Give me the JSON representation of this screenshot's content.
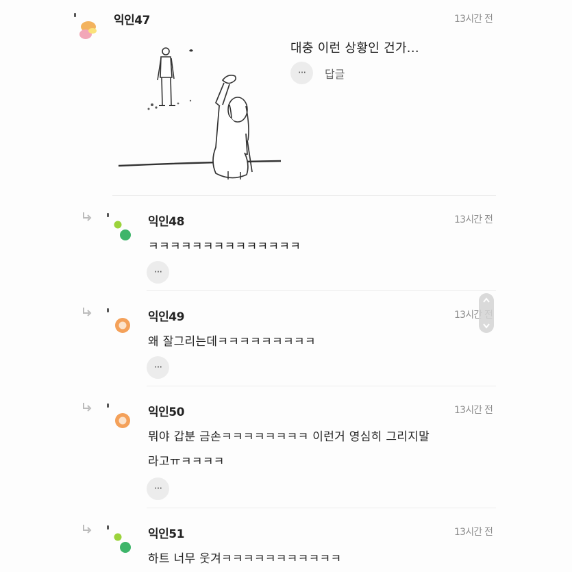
{
  "comments": [
    {
      "nick": "익인47",
      "time": "13시간 전",
      "text": "대충 이런 상황인 건가...",
      "reply_label": "답글",
      "more_label": "···",
      "avatar": "orange-pink-bubble-icon"
    },
    {
      "nick": "익인48",
      "time": "13시간 전",
      "text": "ㅋㅋㅋㅋㅋㅋㅋㅋㅋㅋㅋㅋㅋㅋ",
      "more_label": "···",
      "avatar": "green-dots-icon"
    },
    {
      "nick": "익인49",
      "time": "13시간 전",
      "text": "왜 잘그리는데ㅋㅋㅋㅋㅋㅋㅋㅋㅋ",
      "more_label": "···",
      "avatar": "orange-ring-icon"
    },
    {
      "nick": "익인50",
      "time": "13시간 전",
      "text_line1": "뭐야 갑분 금손ㅋㅋㅋㅋㅋㅋㅋㅋ 이런거 영심히 그리지말",
      "text_line2": "라고ㅠㅋㅋㅋㅋ",
      "more_label": "···",
      "avatar": "orange-ring-icon"
    },
    {
      "nick": "익인51",
      "time": "13시간 전",
      "text": "하트 너무 웃겨ㅋㅋㅋㅋㅋㅋㅋㅋㅋㅋㅋ",
      "avatar": "green-dots-icon"
    }
  ],
  "colors": {
    "orange": "#f3b35e",
    "pink": "#f2a7b8",
    "green_light": "#9bd33b",
    "green": "#3eb56a",
    "ring_orange": "#f4a15a",
    "divider": "#ececec"
  },
  "icons": [
    "reply-arrow-icon",
    "more-options-icon",
    "scroll-handle-icon"
  ]
}
